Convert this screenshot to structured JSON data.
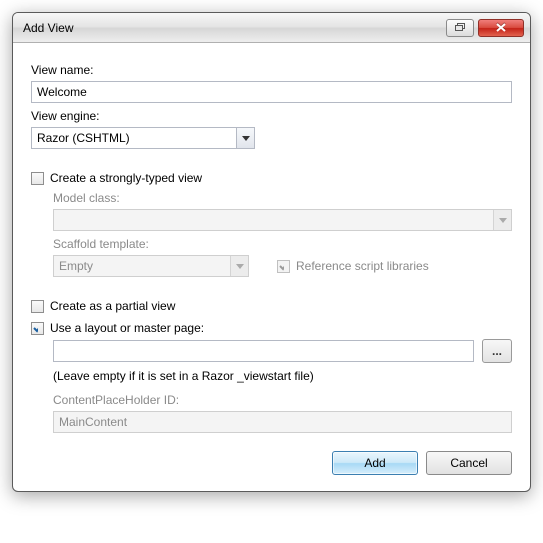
{
  "window": {
    "title": "Add View"
  },
  "form": {
    "view_name_label": "View name:",
    "view_name_value": "Welcome",
    "view_engine_label": "View engine:",
    "view_engine_value": "Razor (CSHTML)",
    "strongly_typed_label": "Create a strongly-typed view",
    "model_class_label": "Model class:",
    "model_class_value": "",
    "scaffold_label": "Scaffold template:",
    "scaffold_value": "Empty",
    "ref_scripts_label": "Reference script libraries",
    "partial_label": "Create as a partial view",
    "layout_label": "Use a layout or master page:",
    "layout_value": "",
    "browse_label": "...",
    "layout_hint": "(Leave empty if it is set in a Razor _viewstart file)",
    "cph_label": "ContentPlaceHolder ID:",
    "cph_value": "MainContent"
  },
  "buttons": {
    "add": "Add",
    "cancel": "Cancel"
  }
}
